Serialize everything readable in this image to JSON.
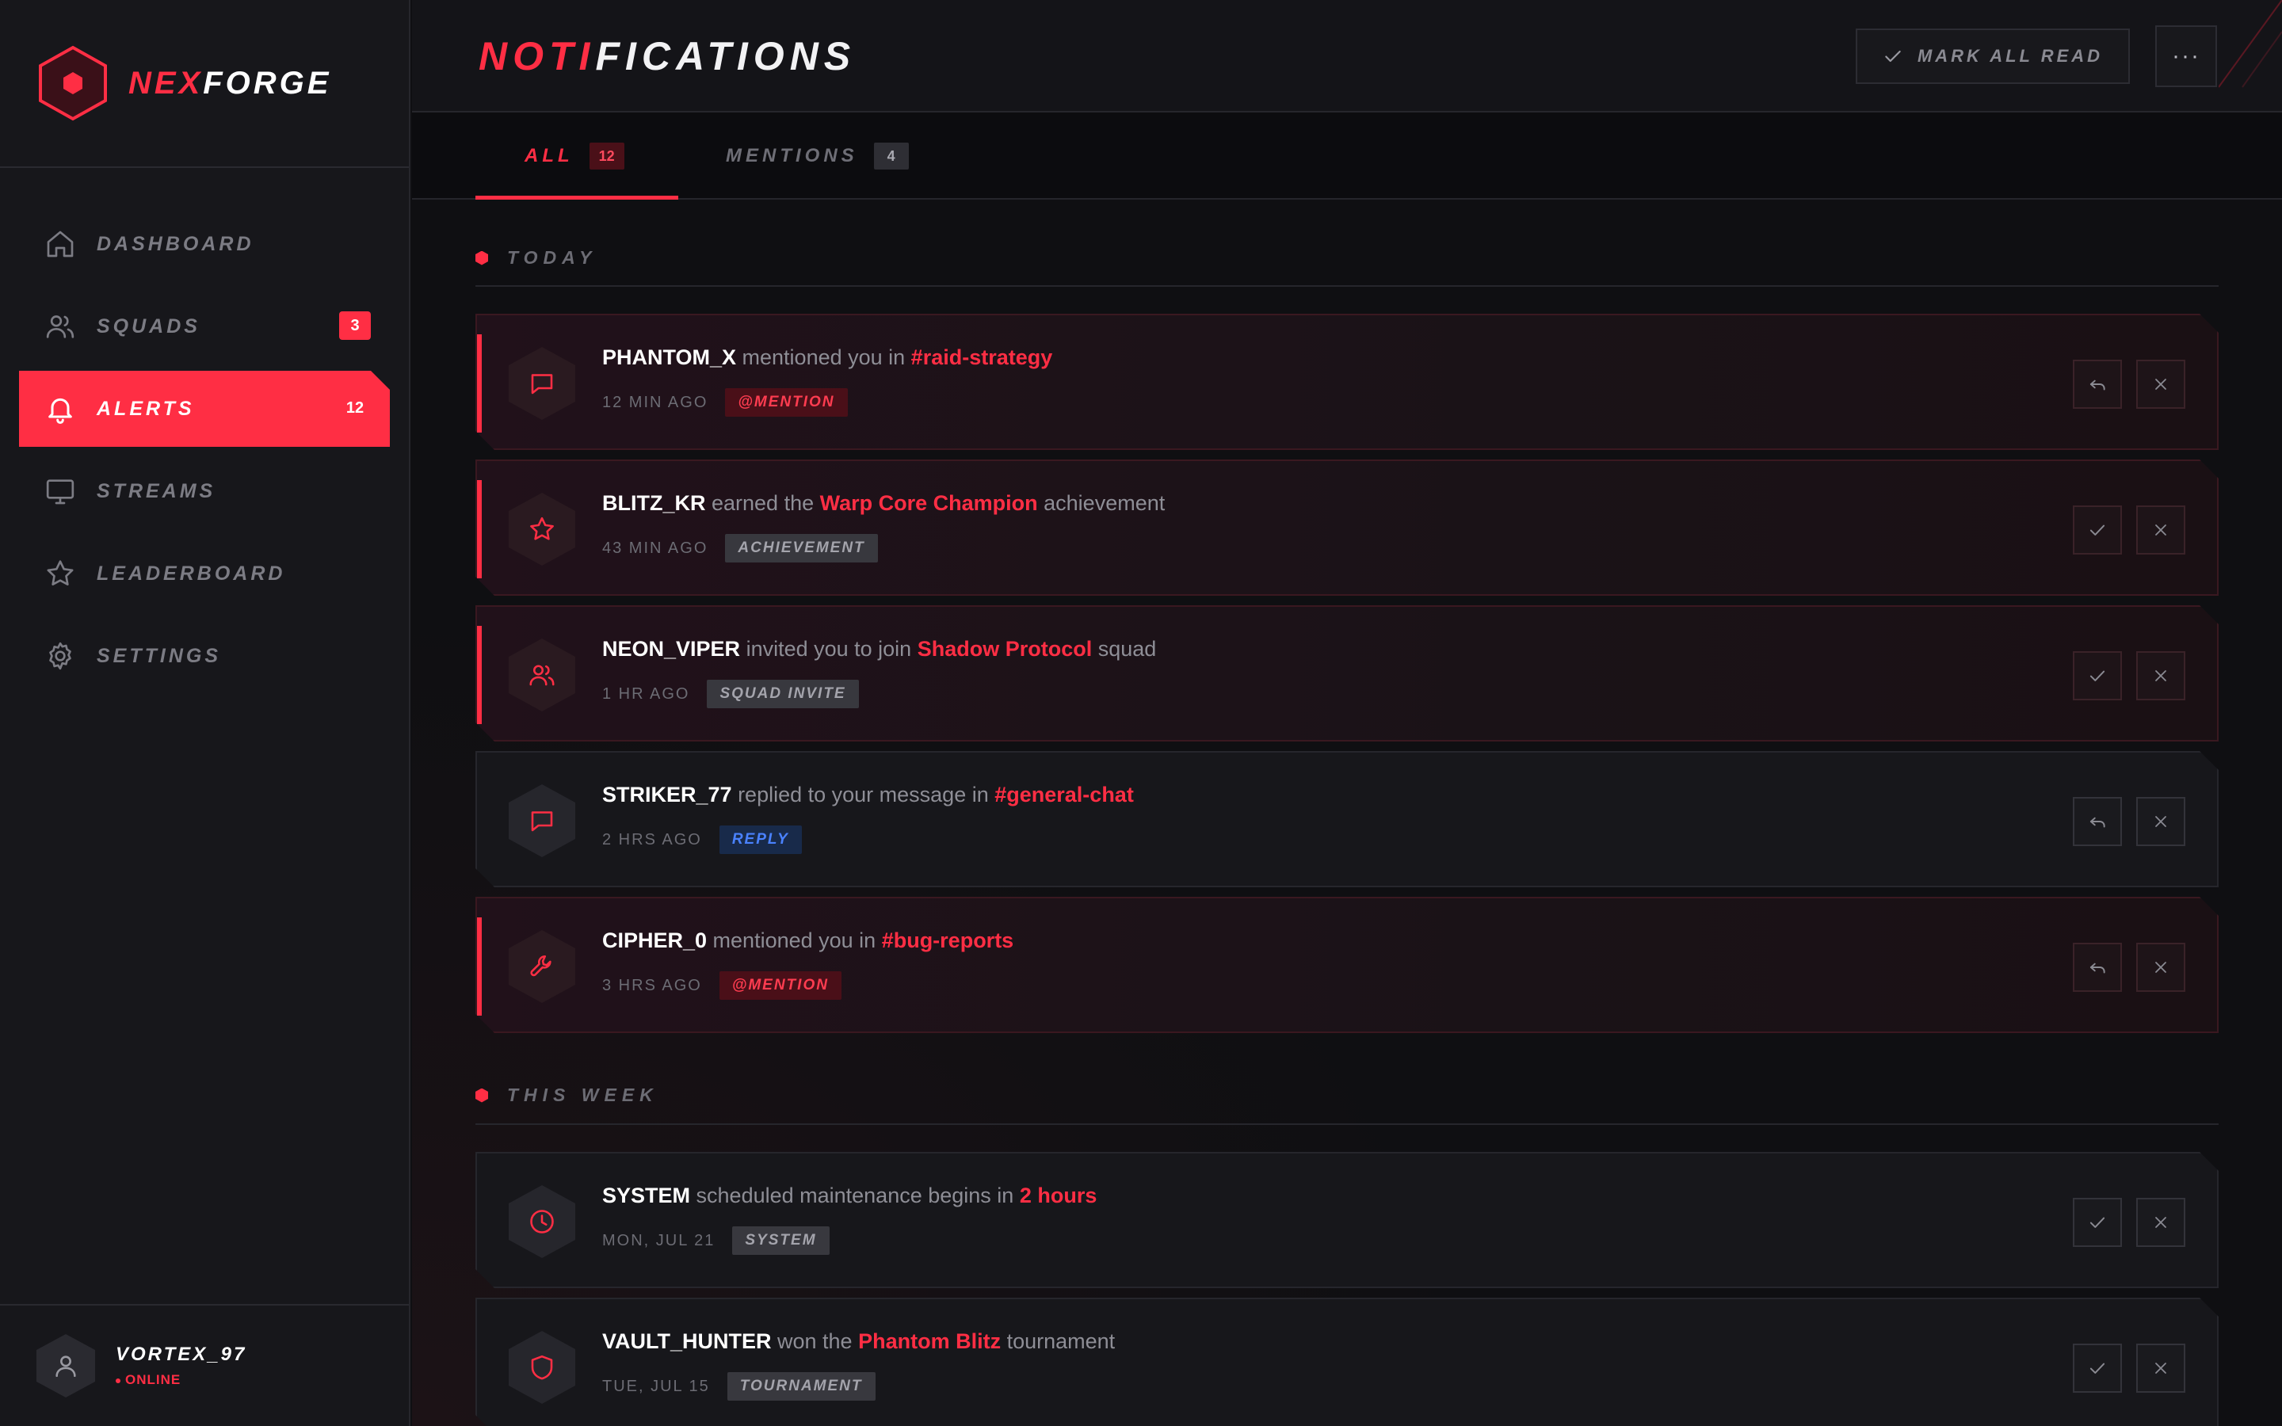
{
  "brand": {
    "part1": "NEX",
    "part2": "FORGE"
  },
  "sidebar": {
    "items": [
      {
        "label": "DASHBOARD",
        "icon": "home-icon",
        "badge": ""
      },
      {
        "label": "SQUADS",
        "icon": "users-icon",
        "badge": "3"
      },
      {
        "label": "ALERTS",
        "icon": "bell-icon",
        "badge": "12",
        "active": true
      },
      {
        "label": "STREAMS",
        "icon": "monitor-icon",
        "badge": ""
      },
      {
        "label": "LEADERBOARD",
        "icon": "star-icon",
        "badge": ""
      },
      {
        "label": "SETTINGS",
        "icon": "gear-icon",
        "badge": ""
      }
    ],
    "user": {
      "name": "VORTEX_97",
      "status": "ONLINE"
    }
  },
  "header": {
    "title_part1": "NOTI",
    "title_part2": "FICATIONS",
    "mark_all_read": "MARK ALL READ",
    "more": "···"
  },
  "tabs": [
    {
      "label": "ALL",
      "count": "12",
      "active": true
    },
    {
      "label": "MENTIONS",
      "count": "4",
      "active": false
    }
  ],
  "sections": {
    "today": "TODAY",
    "this_week": "THIS WEEK"
  },
  "notifications": [
    {
      "user": "PHANTOM_X",
      "pre": " mentioned you in ",
      "highlight": "#raid-strategy",
      "post": "",
      "time": "12 MIN AGO",
      "tag": "@MENTION",
      "icon": "chat-icon",
      "unread": true,
      "primary_action": "reply-icon"
    },
    {
      "user": "BLITZ_KR",
      "pre": " earned the ",
      "highlight": "Warp Core Champion",
      "post": " achievement",
      "time": "43 MIN AGO",
      "tag": "ACHIEVEMENT",
      "icon": "star-icon",
      "unread": true,
      "primary_action": "check-icon"
    },
    {
      "user": "NEON_VIPER",
      "pre": " invited you to join ",
      "highlight": "Shadow Protocol",
      "post": " squad",
      "time": "1 HR AGO",
      "tag": "SQUAD INVITE",
      "icon": "users-icon",
      "unread": true,
      "primary_action": "check-icon"
    },
    {
      "user": "STRIKER_77",
      "pre": " replied to your message in ",
      "highlight": "#general-chat",
      "post": "",
      "time": "2 HRS AGO",
      "tag": "REPLY",
      "icon": "chat-icon",
      "unread": false,
      "primary_action": "reply-icon"
    },
    {
      "user": "CIPHER_0",
      "pre": " mentioned you in ",
      "highlight": "#bug-reports",
      "post": "",
      "time": "3 HRS AGO",
      "tag": "@MENTION",
      "icon": "wrench-icon",
      "unread": true,
      "primary_action": "reply-icon"
    },
    {
      "user": "SYSTEM",
      "pre": " scheduled maintenance begins in ",
      "highlight": "2 hours",
      "post": "",
      "time": "MON, JUL 21",
      "tag": "SYSTEM",
      "icon": "clock-icon",
      "unread": false,
      "primary_action": "check-icon"
    },
    {
      "user": "VAULT_HUNTER",
      "pre": " won the ",
      "highlight": "Phantom Blitz",
      "post": " tournament",
      "time": "TUE, JUL 15",
      "tag": "TOURNAMENT",
      "icon": "shield-icon",
      "unread": false,
      "primary_action": "check-icon"
    }
  ],
  "colors": {
    "accent": "#ff2e44",
    "background": "#0f0f12",
    "sidebar": "#17171b",
    "reply_tag": "#4a82ff"
  }
}
